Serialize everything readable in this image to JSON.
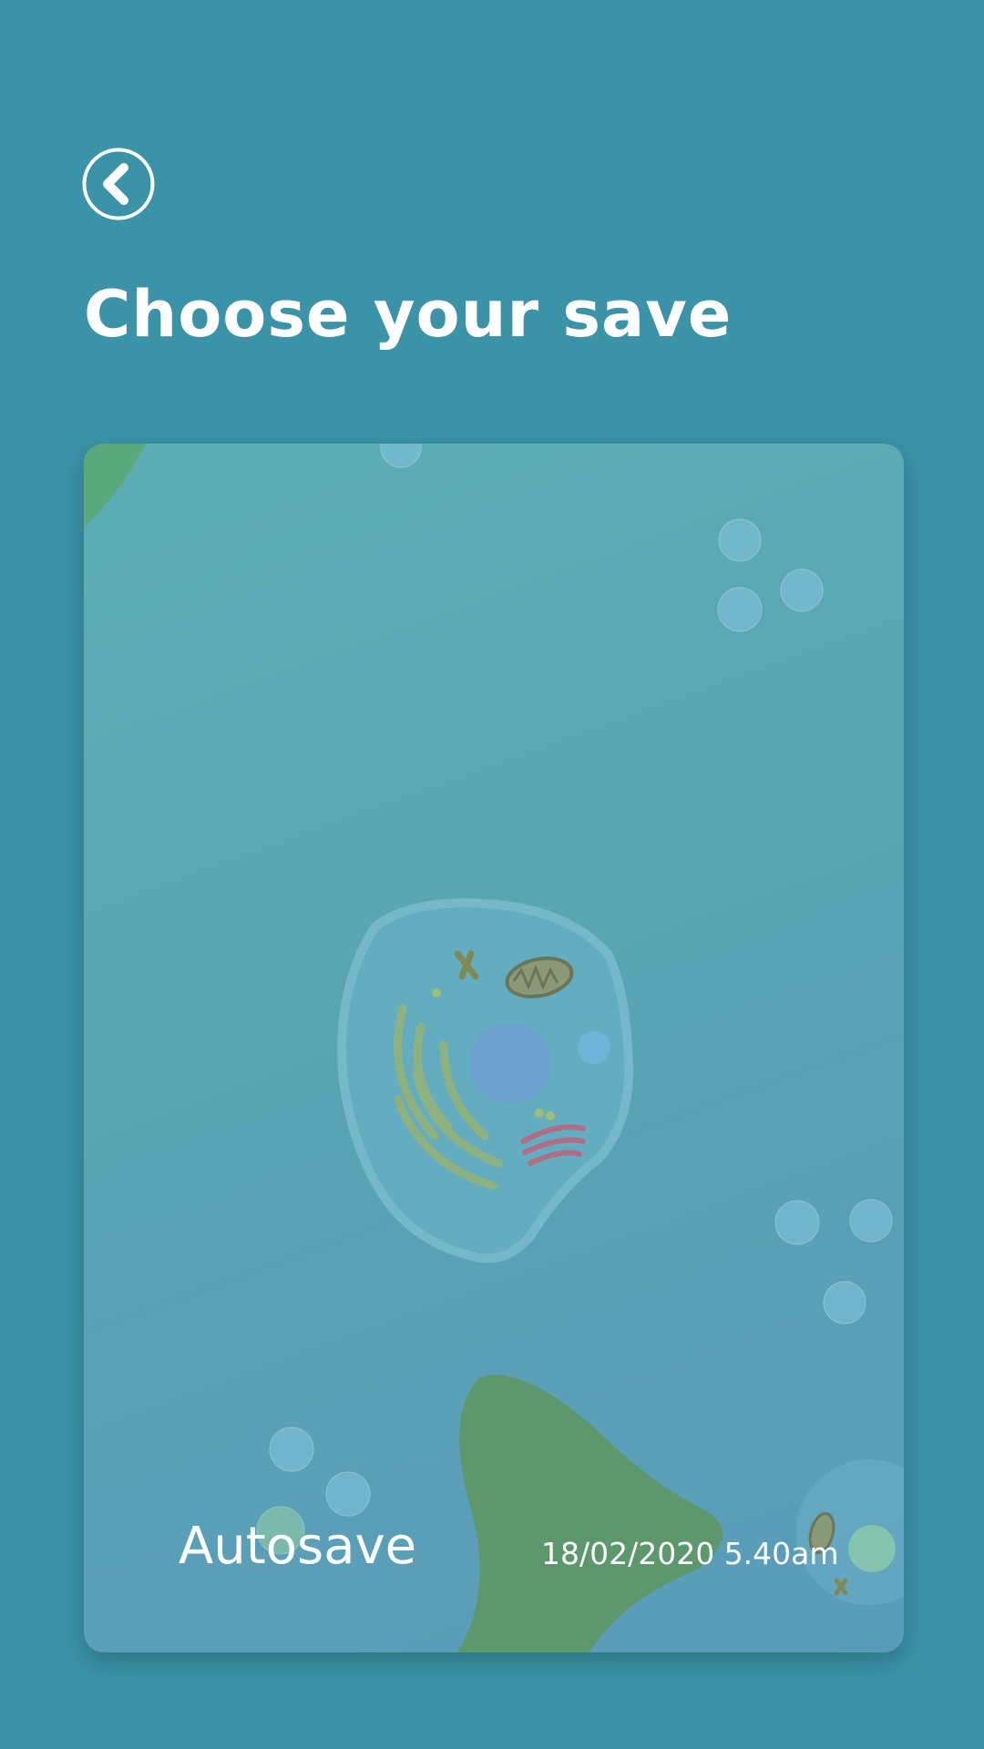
{
  "header": {
    "back_icon": "chevron-left-circle-icon",
    "title": "Choose your save"
  },
  "saves": [
    {
      "name": "Autosave",
      "date": "18/02/2020 5.40am",
      "thumbnail": "animal-cell-illustration"
    }
  ],
  "colors": {
    "background": "#3b93a8",
    "card": "#5aa6b4",
    "text": "#ffffff",
    "seaweed": "#5d9a68"
  }
}
